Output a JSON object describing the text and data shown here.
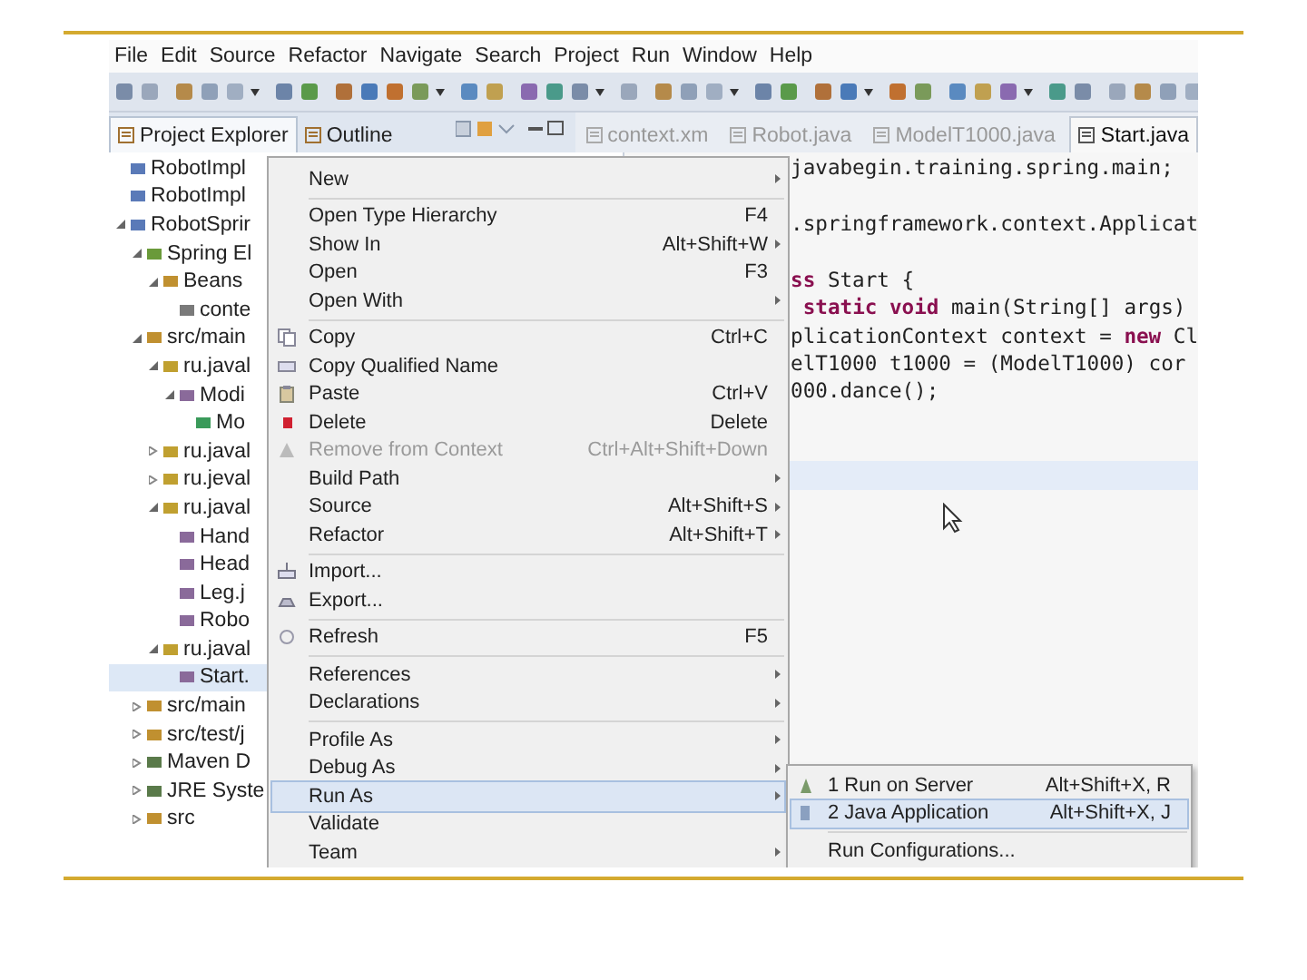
{
  "menu_bar": [
    "File",
    "Edit",
    "Source",
    "Refactor",
    "Navigate",
    "Search",
    "Project",
    "Run",
    "Window",
    "Help"
  ],
  "view_tabs": [
    {
      "label": "Project Explorer",
      "selected": true
    },
    {
      "label": "Outline",
      "selected": false
    }
  ],
  "editor_tabs": [
    {
      "label": "context.xm",
      "selected": false
    },
    {
      "label": "Robot.java",
      "selected": false
    },
    {
      "label": "ModelT1000.java",
      "selected": false
    },
    {
      "label": "Start.java",
      "selected": true
    }
  ],
  "tree": [
    {
      "label": "RobotImpl",
      "kind": "project",
      "selected": false
    },
    {
      "label": "RobotImpl",
      "kind": "project",
      "selected": false
    },
    {
      "label": "RobotSprir",
      "kind": "project",
      "selected": false,
      "expanded": true,
      "children": [
        {
          "label": "Spring El",
          "kind": "spring",
          "selected": false,
          "expanded": true,
          "children": [
            {
              "label": "Beans",
              "kind": "beans",
              "selected": false,
              "expanded": true,
              "children": [
                {
                  "label": "conte",
                  "kind": "xml",
                  "selected": false
                }
              ]
            }
          ]
        },
        {
          "label": "src/main",
          "kind": "srcfolder",
          "selected": false,
          "expanded": true,
          "children": [
            {
              "label": "ru.javal",
              "kind": "package",
              "selected": false,
              "expanded": true,
              "children": [
                {
                  "label": "Modi",
                  "kind": "java",
                  "selected": false,
                  "expanded": true,
                  "children": [
                    {
                      "label": "Mo",
                      "kind": "class",
                      "selected": false
                    }
                  ]
                }
              ]
            },
            {
              "label": "ru.javal",
              "kind": "package",
              "selected": false,
              "expanded": false
            },
            {
              "label": "ru.jeval",
              "kind": "package",
              "selected": false,
              "expanded": false
            },
            {
              "label": "ru.javal",
              "kind": "package",
              "selected": false,
              "expanded": true,
              "children": [
                {
                  "label": "Hand",
                  "kind": "java",
                  "selected": false
                },
                {
                  "label": "Head",
                  "kind": "java",
                  "selected": false
                },
                {
                  "label": "Leg.j",
                  "kind": "java",
                  "selected": false
                },
                {
                  "label": "Robo",
                  "kind": "java",
                  "selected": false
                }
              ]
            },
            {
              "label": "ru.javal",
              "kind": "package",
              "selected": false,
              "expanded": true,
              "children": [
                {
                  "label": "Start.",
                  "kind": "java",
                  "selected": true
                }
              ]
            }
          ]
        },
        {
          "label": "src/main",
          "kind": "srcfolder",
          "selected": false,
          "expanded": false
        },
        {
          "label": "src/test/j",
          "kind": "srcfolder",
          "selected": false,
          "expanded": false
        },
        {
          "label": "Maven D",
          "kind": "library",
          "selected": false,
          "expanded": false
        },
        {
          "label": "JRE Syste",
          "kind": "library",
          "selected": false,
          "expanded": false
        },
        {
          "label": "src",
          "kind": "folder",
          "selected": false,
          "expanded": false
        }
      ]
    }
  ],
  "code_lines": [
    {
      "text": "javabegin.training.spring.main;",
      "current": false
    },
    {
      "current": false
    },
    {
      "text": ".springframework.context.Applicat",
      "current": false
    },
    {
      "current": false
    },
    {
      "text": "**ss** Start {",
      "current": false
    },
    {
      "text": " **static** **void** main(String[] args)",
      "current": false
    },
    {
      "text": "plicationContext context = **new** Cl",
      "current": false
    },
    {
      "text": "elT1000 t1000 = (ModelT1000) cor",
      "current": false
    },
    {
      "text": "000.dance();",
      "current": false
    },
    {
      "current": false
    },
    {
      "current": false
    },
    {
      "current": true
    }
  ],
  "context_menu": [
    {
      "kind": "item",
      "label": "New",
      "submenu": true,
      "selected": false,
      "disabled": false
    },
    {
      "kind": "separator"
    },
    {
      "kind": "item",
      "label": "Open Type Hierarchy",
      "shortcut": "F4",
      "submenu": false,
      "selected": false,
      "disabled": false
    },
    {
      "kind": "item",
      "label": "Show In",
      "shortcut": "Alt+Shift+W",
      "submenu": true,
      "selected": false,
      "disabled": false
    },
    {
      "kind": "item",
      "label": "Open",
      "shortcut": "F3",
      "submenu": false,
      "selected": false,
      "disabled": false
    },
    {
      "kind": "item",
      "label": "Open With",
      "submenu": true,
      "selected": false,
      "disabled": false
    },
    {
      "kind": "separator"
    },
    {
      "kind": "item",
      "label": "Copy",
      "shortcut": "Ctrl+C",
      "submenu": false,
      "selected": false,
      "disabled": false
    },
    {
      "kind": "item",
      "label": "Copy Qualified Name",
      "submenu": false,
      "selected": false,
      "disabled": false
    },
    {
      "kind": "item",
      "label": "Paste",
      "shortcut": "Ctrl+V",
      "submenu": false,
      "selected": false,
      "disabled": false
    },
    {
      "kind": "item",
      "label": "Delete",
      "shortcut": "Delete",
      "submenu": false,
      "selected": false,
      "disabled": false
    },
    {
      "kind": "item",
      "label": "Remove from Context",
      "shortcut": "Ctrl+Alt+Shift+Down",
      "submenu": false,
      "selected": false,
      "disabled": true
    },
    {
      "kind": "item",
      "label": "Build Path",
      "submenu": true,
      "selected": false,
      "disabled": false
    },
    {
      "kind": "item",
      "label": "Source",
      "shortcut": "Alt+Shift+S",
      "submenu": true,
      "selected": false,
      "disabled": false
    },
    {
      "kind": "item",
      "label": "Refactor",
      "shortcut": "Alt+Shift+T",
      "submenu": true,
      "selected": false,
      "disabled": false
    },
    {
      "kind": "separator"
    },
    {
      "kind": "item",
      "label": "Import...",
      "submenu": false,
      "selected": false,
      "disabled": false
    },
    {
      "kind": "item",
      "label": "Export...",
      "submenu": false,
      "selected": false,
      "disabled": false
    },
    {
      "kind": "separator"
    },
    {
      "kind": "item",
      "label": "Refresh",
      "shortcut": "F5",
      "submenu": false,
      "selected": false,
      "disabled": false
    },
    {
      "kind": "separator"
    },
    {
      "kind": "item",
      "label": "References",
      "submenu": true,
      "selected": false,
      "disabled": false
    },
    {
      "kind": "item",
      "label": "Declarations",
      "submenu": true,
      "selected": false,
      "disabled": false
    },
    {
      "kind": "separator"
    },
    {
      "kind": "item",
      "label": "Profile As",
      "submenu": true,
      "selected": false,
      "disabled": false
    },
    {
      "kind": "item",
      "label": "Debug As",
      "submenu": true,
      "selected": false,
      "disabled": false
    },
    {
      "kind": "item",
      "label": "Run As",
      "submenu": true,
      "selected": true,
      "disabled": false
    },
    {
      "kind": "item",
      "label": "Validate",
      "submenu": false,
      "selected": false,
      "disabled": false
    },
    {
      "kind": "item",
      "label": "Team",
      "submenu": true,
      "selected": false,
      "disabled": false
    }
  ],
  "run_as_submenu": [
    {
      "kind": "item",
      "label": "1 Run on Server",
      "shortcut": "Alt+Shift+X, R",
      "submenu": false,
      "selected": false,
      "disabled": false
    },
    {
      "kind": "item",
      "label": "2 Java Application",
      "shortcut": "Alt+Shift+X, J",
      "submenu": false,
      "selected": true,
      "disabled": false
    },
    {
      "kind": "separator"
    },
    {
      "kind": "item",
      "label": "Run Configurations...",
      "submenu": false,
      "selected": false,
      "disabled": false
    }
  ]
}
